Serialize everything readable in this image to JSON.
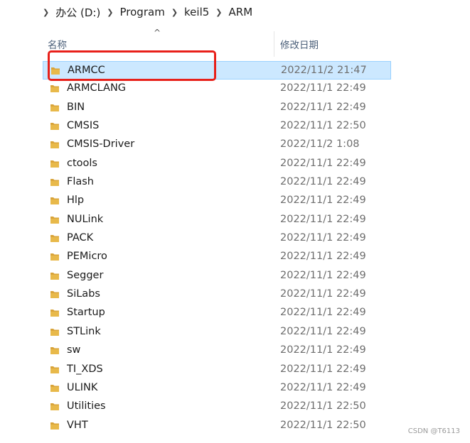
{
  "breadcrumb": [
    "办公 (D:)",
    "Program",
    "keil5",
    "ARM"
  ],
  "header": {
    "name_label": "名称",
    "date_label": "修改日期",
    "sort_glyph": "^"
  },
  "rows": [
    {
      "name": "ARMCC",
      "date": "2022/11/2 21:47",
      "selected": true
    },
    {
      "name": "ARMCLANG",
      "date": "2022/11/1 22:49"
    },
    {
      "name": "BIN",
      "date": "2022/11/1 22:49"
    },
    {
      "name": "CMSIS",
      "date": "2022/11/1 22:50"
    },
    {
      "name": "CMSIS-Driver",
      "date": "2022/11/2 1:08"
    },
    {
      "name": "ctools",
      "date": "2022/11/1 22:49"
    },
    {
      "name": "Flash",
      "date": "2022/11/1 22:49"
    },
    {
      "name": "Hlp",
      "date": "2022/11/1 22:49"
    },
    {
      "name": "NULink",
      "date": "2022/11/1 22:49"
    },
    {
      "name": "PACK",
      "date": "2022/11/1 22:49"
    },
    {
      "name": "PEMicro",
      "date": "2022/11/1 22:49"
    },
    {
      "name": "Segger",
      "date": "2022/11/1 22:49"
    },
    {
      "name": "SiLabs",
      "date": "2022/11/1 22:49"
    },
    {
      "name": "Startup",
      "date": "2022/11/1 22:49"
    },
    {
      "name": "STLink",
      "date": "2022/11/1 22:49"
    },
    {
      "name": "sw",
      "date": "2022/11/1 22:49"
    },
    {
      "name": "TI_XDS",
      "date": "2022/11/1 22:49"
    },
    {
      "name": "ULINK",
      "date": "2022/11/1 22:49"
    },
    {
      "name": "Utilities",
      "date": "2022/11/1 22:50"
    },
    {
      "name": "VHT",
      "date": "2022/11/1 22:50"
    }
  ],
  "icons": {
    "folder": "folder-icon",
    "separator": "chevron-right-icon"
  },
  "colors": {
    "selection": "#cce8ff",
    "highlight": "#e8201a",
    "folder": "#e8b94a"
  },
  "watermark": "CSDN @T6113"
}
